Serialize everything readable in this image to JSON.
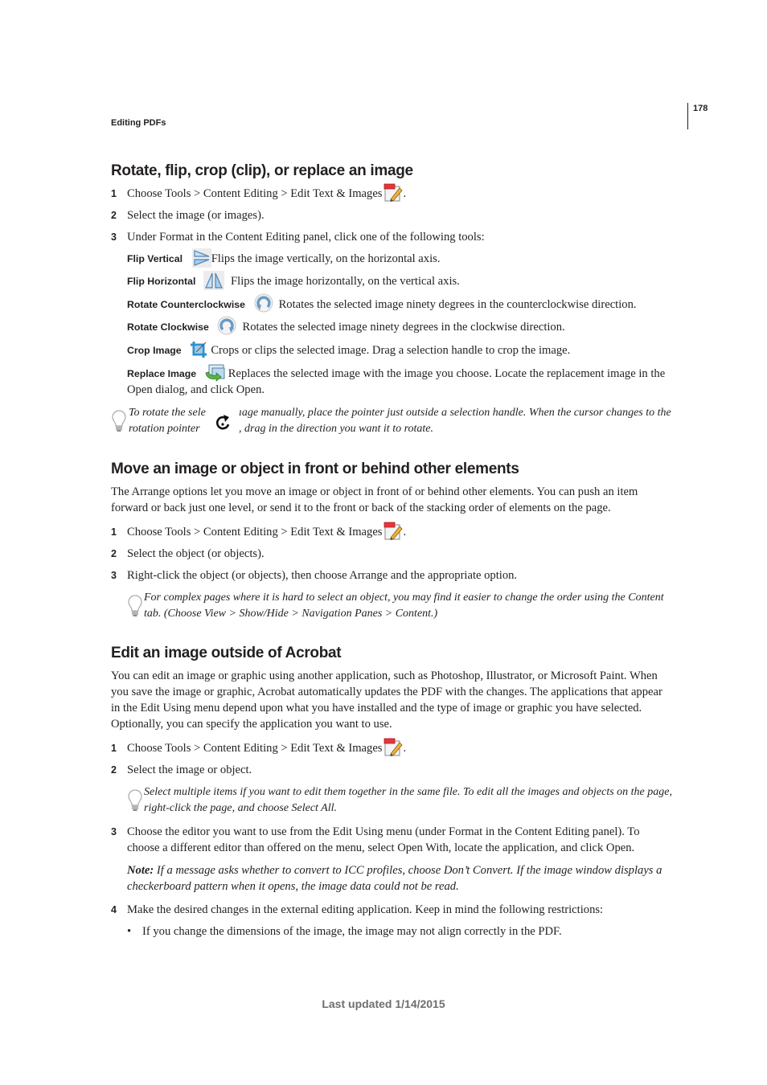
{
  "header": {
    "running_head": "Editing PDFs",
    "page_number": "178"
  },
  "section1": {
    "title": "Rotate, flip, crop (clip), or replace an image",
    "steps": [
      {
        "num": "1",
        "text": "Choose Tools > Content Editing > Edit Text & Images",
        "icon": "edit-text-images-icon",
        "trail": "."
      },
      {
        "num": "2",
        "text": "Select the image (or images)."
      },
      {
        "num": "3",
        "text": "Under Format in the Content Editing panel, click one of the following tools:"
      }
    ],
    "tools": [
      {
        "label": "Flip Vertical",
        "icon": "flip-vertical-icon",
        "desc": "Flips the image vertically, on the horizontal axis."
      },
      {
        "label": "Flip Horizontal",
        "icon": "flip-horizontal-icon",
        "desc": "Flips the image horizontally, on the vertical axis."
      },
      {
        "label": "Rotate Counterclockwise",
        "icon": "rotate-counterclockwise-icon",
        "desc": "Rotates the selected image ninety degrees in the counterclockwise direction."
      },
      {
        "label": "Rotate Clockwise",
        "icon": "rotate-clockwise-icon",
        "desc": "Rotates the selected image ninety degrees in the clockwise direction."
      },
      {
        "label": "Crop Image",
        "icon": "crop-icon",
        "desc": "Crops or clips the selected image. Drag a selection handle to crop the image."
      },
      {
        "label": "Replace Image",
        "icon": "replace-image-icon",
        "desc": "Replaces the selected image with the image you choose. Locate the replacement image in the",
        "desc2": "Open dialog, and click Open."
      }
    ],
    "tip": {
      "line1_a": "To rotate the sele",
      "line1_b": "ıage manually, place the pointer just outside a selection handle. When the cursor changes to the",
      "line2_a": "rotation pointer",
      "line2_b": ", drag in the direction you want it to rotate."
    }
  },
  "section2": {
    "title": "Move an image or object in front or behind other elements",
    "intro": [
      "The Arrange options let you move an image or object in front of or behind other elements. You can push an item",
      "forward or back just one level, or send it to the front or back of the stacking order of elements on the page."
    ],
    "steps": [
      {
        "num": "1",
        "text": "Choose Tools > Content Editing > Edit Text & Images",
        "trail": "."
      },
      {
        "num": "2",
        "text": "Select the object (or objects)."
      },
      {
        "num": "3",
        "text": "Right-click the object (or objects), then choose Arrange and the appropriate option."
      }
    ],
    "tip": [
      "For complex pages where it is hard to select an object, you may find it easier to change the order using the Content",
      "tab. (Choose View > Show/Hide > Navigation Panes > Content.)"
    ]
  },
  "section3": {
    "title": "Edit an image outside of Acrobat",
    "intro": [
      "You can edit an image or graphic using another application, such as Photoshop, Illustrator, or Microsoft Paint. When",
      "you save the image or graphic, Acrobat automatically updates the PDF with the changes. The applications that appear",
      "in the Edit Using menu depend upon what you have installed and the type of image or graphic you have selected.",
      "Optionally, you can specify the application you want to use."
    ],
    "steps": [
      {
        "num": "1",
        "text": "Choose Tools > Content Editing > Edit Text & Images",
        "trail": "."
      },
      {
        "num": "2",
        "text": "Select the image or object."
      },
      {
        "num": "3",
        "lines": [
          "Choose the editor you want to use from the Edit Using menu (under Format in the Content Editing panel). To",
          "choose a different editor than offered on the menu, select Open With, locate the application, and click Open."
        ]
      },
      {
        "num": "4",
        "text": "Make the desired changes in the external editing application. Keep in mind the following restrictions:"
      }
    ],
    "tip": [
      "Select multiple items if you want to edit them together in the same file. To edit all the images and objects on the page,",
      "right-click the page, and choose Select All."
    ],
    "note": {
      "lead": "Note:",
      "line1": " If a message asks whether to convert to ICC profiles, choose Don’t Convert. If the image window displays a",
      "line2": "checkerboard pattern when it opens, the image data could not be read."
    },
    "bullets": [
      "If you change the dimensions of the image, the image may not align correctly in the PDF."
    ]
  },
  "footer": {
    "last_updated": "Last updated 1/14/2015"
  }
}
